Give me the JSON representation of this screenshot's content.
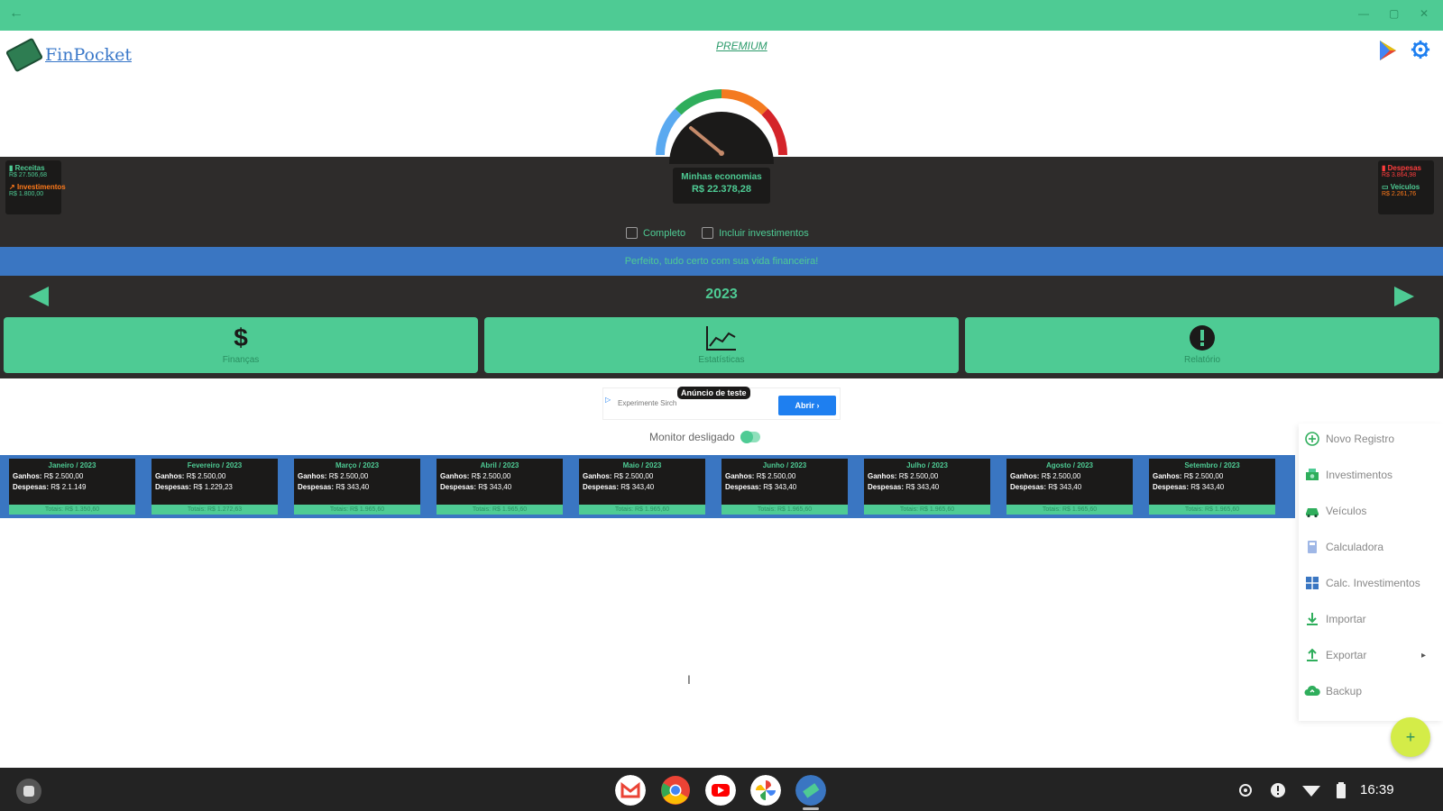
{
  "app": {
    "logo_text": "FinPocket",
    "premium_label": "PREMIUM"
  },
  "gauge": {
    "label": "Minhas economias",
    "value": "R$ 22.378,28"
  },
  "stats_left": {
    "receitas_label": "Receitas",
    "receitas_value": "R$ 27.506,68",
    "investimentos_label": "Investimentos",
    "investimentos_value": "R$ 1.800,00"
  },
  "stats_right": {
    "despesas_label": "Despesas",
    "despesas_value": "R$ 3.864,98",
    "veiculos_label": "Veículos",
    "veiculos_value": "R$ 2.261,76"
  },
  "checkboxes": {
    "completo": "Completo",
    "incluir_investimentos": "Incluir investimentos"
  },
  "banner": {
    "message": "Perfeito, tudo certo com sua vida financeira!"
  },
  "year_nav": {
    "year": "2023"
  },
  "tabs": [
    {
      "label": "Finanças"
    },
    {
      "label": "Estatísticas"
    },
    {
      "label": "Relatório"
    }
  ],
  "ad": {
    "tag": "Anúncio de teste",
    "text": "Experimente Sirch",
    "button": "Abrir ›"
  },
  "monitor": {
    "label": "Monitor desligado"
  },
  "months": [
    {
      "title": "Janeiro / 2023",
      "ganhos_label": "Ganhos:",
      "ganhos_value": "R$ 2.500,00",
      "despesas_label": "Despesas:",
      "despesas_value": "R$ 2.1.149",
      "total": "Totais: R$ 1.350,60"
    },
    {
      "title": "Fevereiro / 2023",
      "ganhos_label": "Ganhos:",
      "ganhos_value": "R$ 2.500,00",
      "despesas_label": "Despesas:",
      "despesas_value": "R$ 1.229,23",
      "total": "Totais: R$ 1.272,63"
    },
    {
      "title": "Março / 2023",
      "ganhos_label": "Ganhos:",
      "ganhos_value": "R$ 2.500,00",
      "despesas_label": "Despesas:",
      "despesas_value": "R$ 343,40",
      "total": "Totais: R$ 1.965,60"
    },
    {
      "title": "Abril / 2023",
      "ganhos_label": "Ganhos:",
      "ganhos_value": "R$ 2.500,00",
      "despesas_label": "Despesas:",
      "despesas_value": "R$ 343,40",
      "total": "Totais: R$ 1.965,60"
    },
    {
      "title": "Maio / 2023",
      "ganhos_label": "Ganhos:",
      "ganhos_value": "R$ 2.500,00",
      "despesas_label": "Despesas:",
      "despesas_value": "R$ 343,40",
      "total": "Totais: R$ 1.965,60"
    },
    {
      "title": "Junho / 2023",
      "ganhos_label": "Ganhos:",
      "ganhos_value": "R$ 2.500,00",
      "despesas_label": "Despesas:",
      "despesas_value": "R$ 343,40",
      "total": "Totais: R$ 1.965,60"
    },
    {
      "title": "Julho / 2023",
      "ganhos_label": "Ganhos:",
      "ganhos_value": "R$ 2.500,00",
      "despesas_label": "Despesas:",
      "despesas_value": "R$ 343,40",
      "total": "Totais: R$ 1.965,60"
    },
    {
      "title": "Agosto / 2023",
      "ganhos_label": "Ganhos:",
      "ganhos_value": "R$ 2.500,00",
      "despesas_label": "Despesas:",
      "despesas_value": "R$ 343,40",
      "total": "Totais: R$ 1.965,60"
    },
    {
      "title": "Setembro / 2023",
      "ganhos_label": "Ganhos:",
      "ganhos_value": "R$ 2.500,00",
      "despesas_label": "Despesas:",
      "despesas_value": "R$ 343,40",
      "total": "Totais: R$ 1.965,60"
    }
  ],
  "menu": [
    {
      "label": "Novo Registro",
      "icon": "add-circle-icon"
    },
    {
      "label": "Investimentos",
      "icon": "money-icon"
    },
    {
      "label": "Veículos",
      "icon": "car-icon"
    },
    {
      "label": "Calculadora",
      "icon": "calculator-icon"
    },
    {
      "label": "Calc. Investimentos",
      "icon": "grid-calc-icon"
    },
    {
      "label": "Importar",
      "icon": "download-icon"
    },
    {
      "label": "Exportar",
      "icon": "upload-icon",
      "caret": "▸"
    },
    {
      "label": "Backup",
      "icon": "cloud-upload-icon"
    }
  ],
  "fab": {
    "symbol": "+"
  },
  "taskbar": {
    "clock": "16:39",
    "apps": [
      "gmail-icon",
      "chrome-icon",
      "youtube-icon",
      "photos-icon",
      "finpocket-icon"
    ]
  },
  "colors": {
    "accent_green": "#4ecb94",
    "dark_bg": "#2e2c2b",
    "banner_blue": "#3a76c2",
    "fab_yellow": "#d4ec48"
  }
}
